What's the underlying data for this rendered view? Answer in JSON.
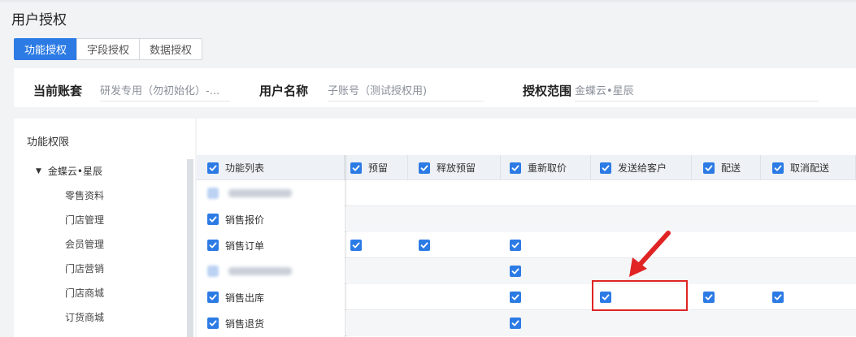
{
  "page": {
    "title": "用户授权"
  },
  "tabs": [
    {
      "label": "功能授权",
      "active": true
    },
    {
      "label": "字段授权",
      "active": false
    },
    {
      "label": "数据授权",
      "active": false
    }
  ],
  "filters": {
    "account_label": "当前账套",
    "account_value": "研发专用（勿初始化）-...",
    "user_label": "用户名称",
    "user_value": "子账号（测试授权用)",
    "scope_label": "授权范围",
    "scope_value": "金蝶云•星辰"
  },
  "left_panel": {
    "title": "功能权限",
    "root": "金蝶云•星辰",
    "items": [
      "零售资料",
      "门店管理",
      "会员管理",
      "门店营销",
      "门店商城",
      "订货商城"
    ]
  },
  "grid": {
    "columns": [
      "功能列表",
      "预留",
      "释放预留",
      "重新取价",
      "发送给客户",
      "配送",
      "取消配送"
    ],
    "rows": [
      {
        "name": "",
        "redacted": true,
        "checked": [
          false,
          false,
          false,
          false,
          false,
          false
        ]
      },
      {
        "name": "销售报价",
        "redacted": false,
        "checked": [
          false,
          false,
          false,
          false,
          false,
          false
        ]
      },
      {
        "name": "销售订单",
        "redacted": false,
        "checked": [
          true,
          true,
          true,
          false,
          false,
          false
        ]
      },
      {
        "name": "",
        "redacted": true,
        "checked": [
          false,
          false,
          true,
          false,
          false,
          false
        ]
      },
      {
        "name": "销售出库",
        "redacted": false,
        "checked": [
          false,
          false,
          true,
          true,
          true,
          true
        ]
      },
      {
        "name": "销售退货",
        "redacted": false,
        "checked": [
          false,
          false,
          true,
          false,
          false,
          false
        ]
      }
    ]
  },
  "colors": {
    "accent": "#2c7be5",
    "highlight": "#e02424"
  },
  "icons": {
    "tree_caret": "caret-down-icon",
    "check": "check-icon",
    "annotation": "red-arrow-icon"
  }
}
